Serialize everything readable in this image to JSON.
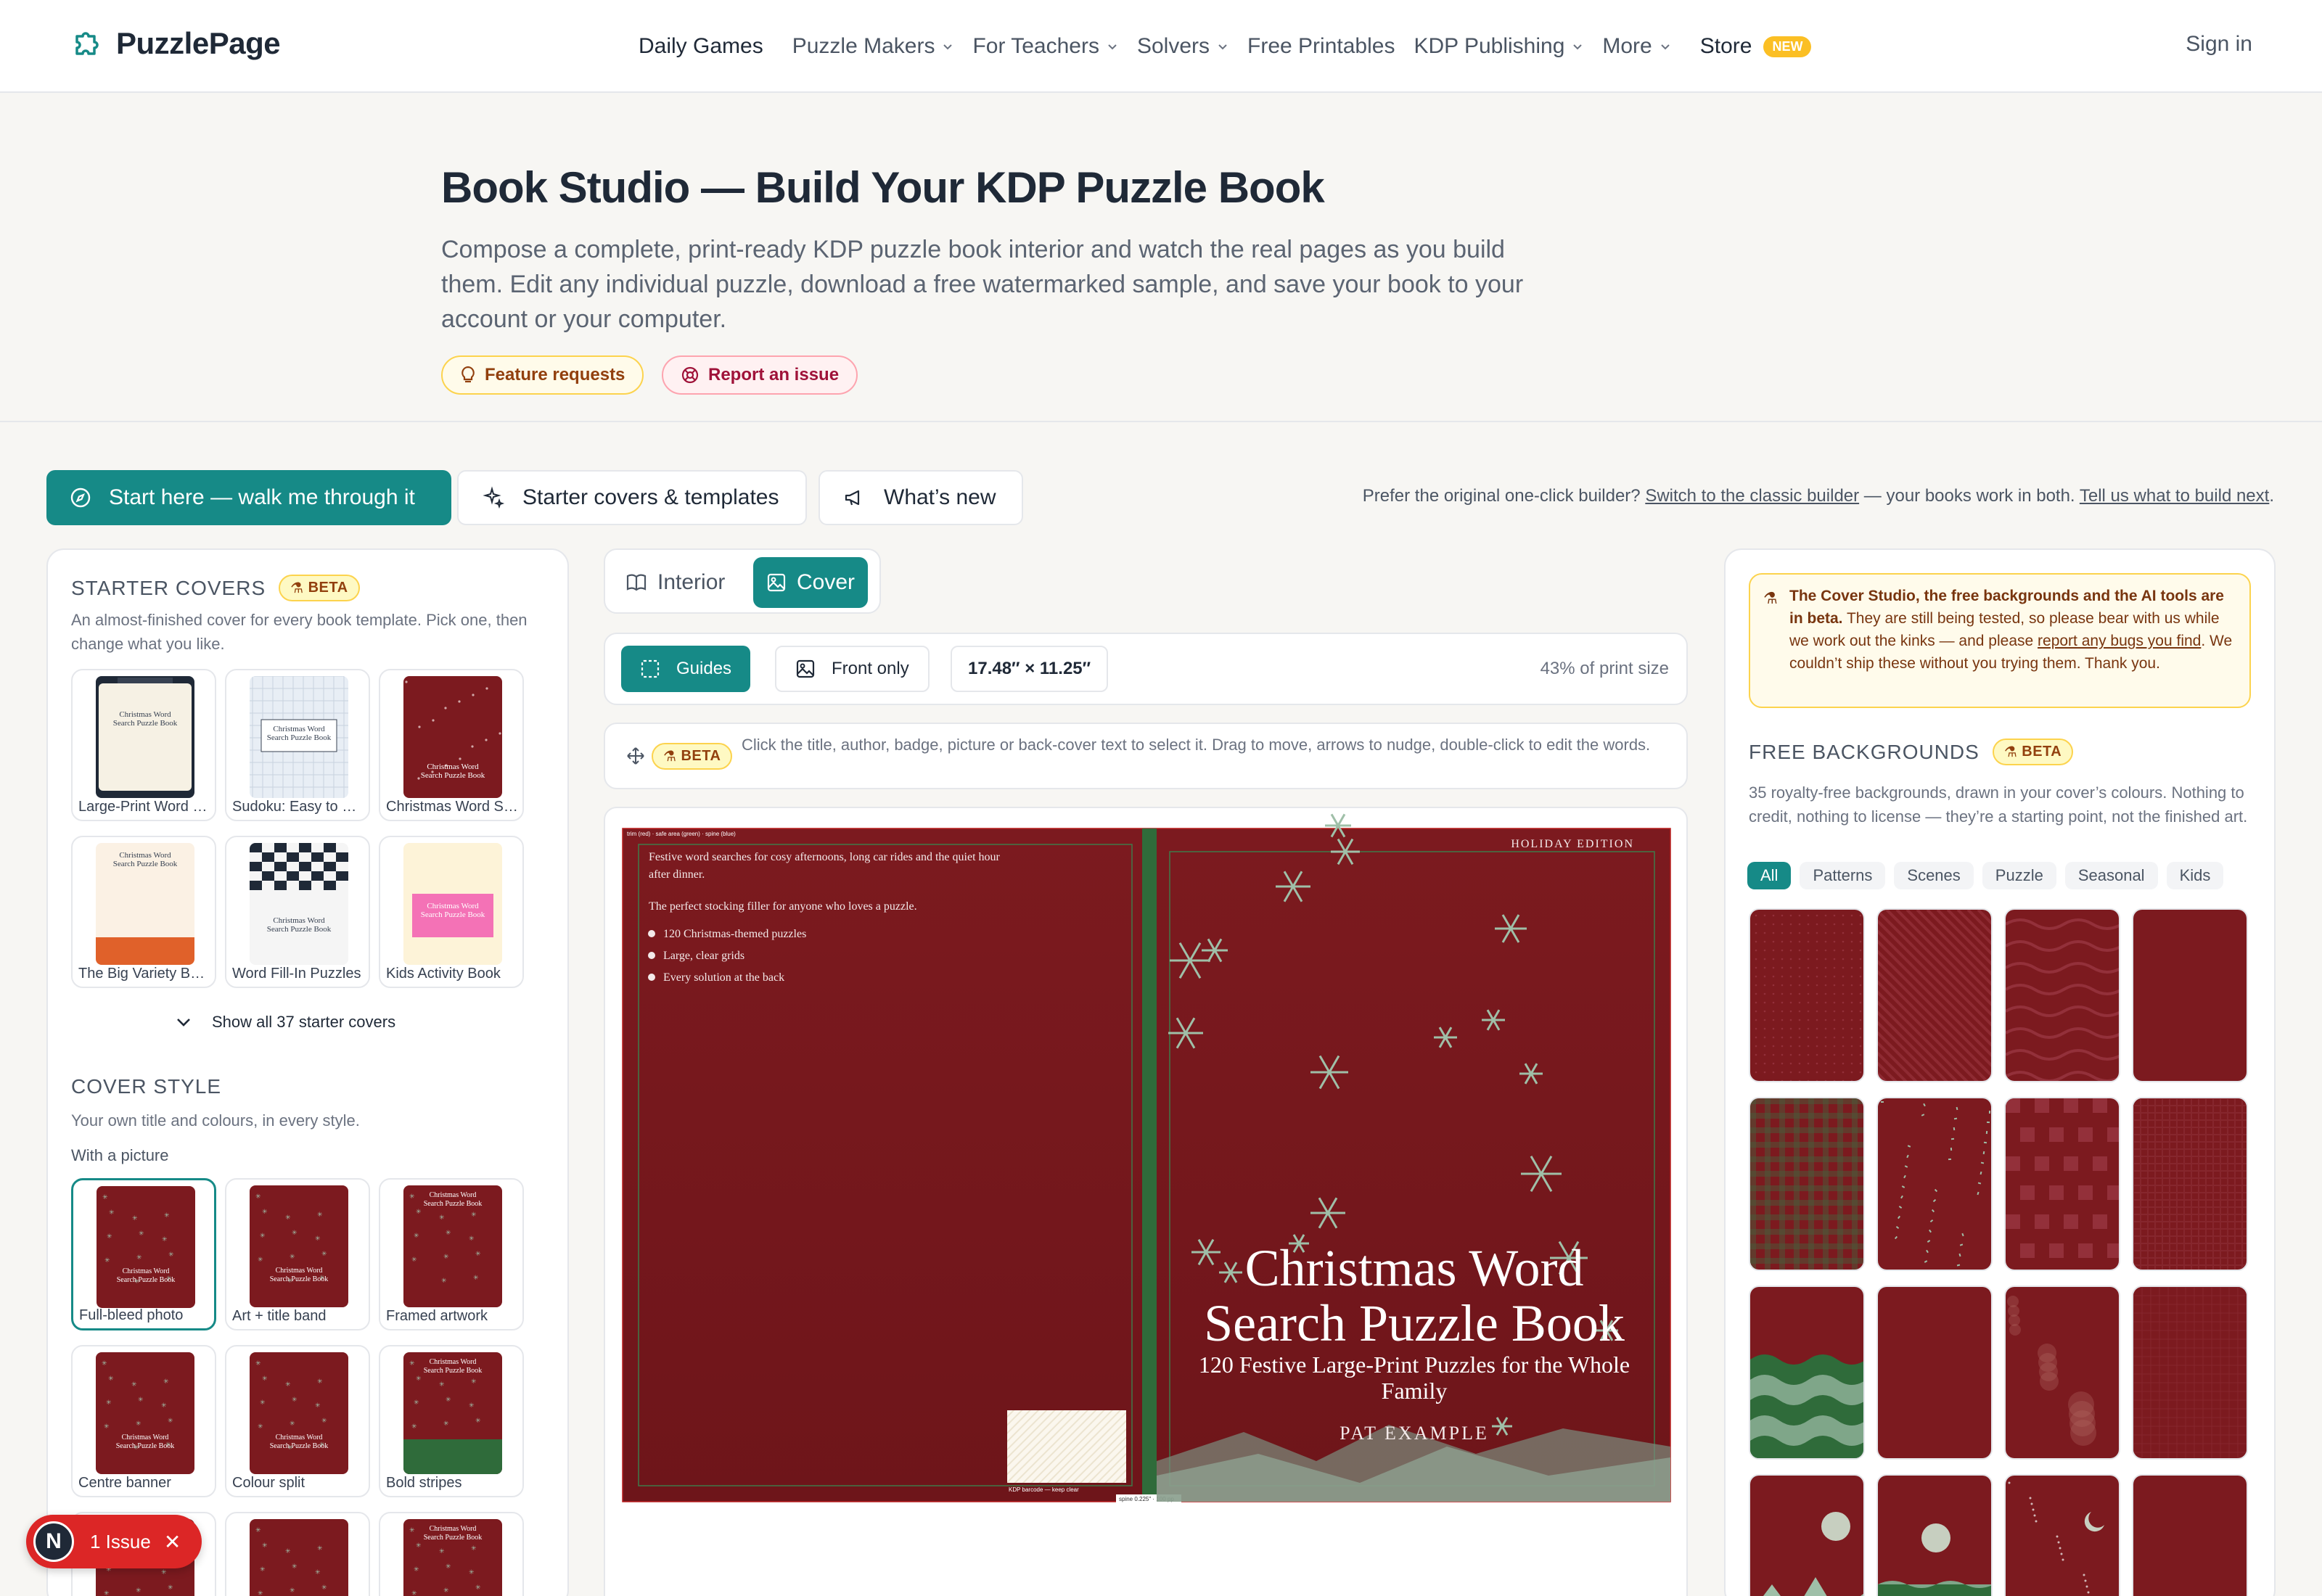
{
  "nav": {
    "brand": "PuzzlePage",
    "links": [
      {
        "label": "Daily Games",
        "dropdown": false,
        "dark": true
      },
      {
        "label": "Puzzle Makers",
        "dropdown": true
      },
      {
        "label": "For Teachers",
        "dropdown": true
      },
      {
        "label": "Solvers",
        "dropdown": true
      },
      {
        "label": "Free Printables",
        "dropdown": false
      },
      {
        "label": "KDP Publishing",
        "dropdown": true
      },
      {
        "label": "More",
        "dropdown": true
      }
    ],
    "store_label": "Store",
    "store_badge": "NEW",
    "signin": "Sign in"
  },
  "hero": {
    "title": "Book Studio — Build Your KDP Puzzle Book",
    "description": "Compose a complete, print-ready KDP puzzle book interior and watch the real pages as you build them. Edit any individual puzzle, download a free watermarked sample, and save your book to your account or your computer.",
    "feature_requests": "Feature requests",
    "report_issue": "Report an issue"
  },
  "toolbar": {
    "start_here": "Start here — walk me through it",
    "starter_covers": "Starter covers & templates",
    "whats_new": "What’s new",
    "note_prefix": "Prefer the original one-click builder?",
    "note_link1": "Switch to the classic builder",
    "note_middle": "— your books work in both.",
    "note_link2": "Tell us what to build next",
    "note_suffix": "."
  },
  "starter_covers": {
    "heading": "STARTER COVERS",
    "beta": "BETA",
    "description": "An almost-finished cover for every book template. Pick one, then change what you like.",
    "items": [
      {
        "label": "Large-Print Word Search",
        "thumb_text": "Christmas Word Search Puzzle Book"
      },
      {
        "label": "Sudoku: Easy to Hard",
        "thumb_text": "Christmas Word Search Puzzle Book"
      },
      {
        "label": "Christmas Word Search",
        "thumb_text": "Christmas Word Search Puzzle Book"
      },
      {
        "label": "The Big Variety Book",
        "thumb_text": "Christmas Word Search Puzzle Book"
      },
      {
        "label": "Word Fill-In Puzzles",
        "thumb_text": "Christmas Word Search Puzzle Book"
      },
      {
        "label": "Kids Activity Book",
        "thumb_text": "Christmas Word Search Puzzle Book"
      }
    ],
    "show_all": "Show all 37 starter covers"
  },
  "cover_style": {
    "heading": "COVER STYLE",
    "description": "Your own title and colours, in every style.",
    "subheading": "With a picture",
    "items": [
      {
        "label": "Full-bleed photo"
      },
      {
        "label": "Art + title band"
      },
      {
        "label": "Framed artwork"
      },
      {
        "label": "Centre banner"
      },
      {
        "label": "Colour split"
      },
      {
        "label": "Bold stripes"
      },
      {
        "label": ""
      },
      {
        "label": ""
      },
      {
        "label": ""
      }
    ]
  },
  "editor": {
    "tab_interior": "Interior",
    "tab_cover": "Cover",
    "guides": "Guides",
    "front_only": "Front only",
    "size": "17.48″ × 11.25″",
    "print_pct": "43% of print size",
    "beta": "BETA",
    "hint": "Click the title, author, badge, picture or back-cover text to select it. Drag to move, arrows to nudge, double-click to edit the words."
  },
  "cover": {
    "guide_label": "trim (red) · safe area (green) · spine (blue)",
    "back_blurb": "Festive word searches for cosy afternoons, long car rides and the quiet hour after dinner.",
    "back_tag": "The perfect stocking filler for anyone who loves a puzzle.",
    "bullets": [
      "120 Christmas-themed puzzles",
      "Large, clear grids",
      "Every solution at the back"
    ],
    "barcode_label": "KDP barcode — keep clear",
    "spine_label": "spine 0.225″ · 100 pp",
    "badge": "HOLIDAY EDITION",
    "title_line1": "Christmas Word",
    "title_line2": "Search Puzzle Book",
    "subtitle_line1": "120 Festive Large-Print Puzzles for the Whole",
    "subtitle_line2": "Family",
    "author": "PAT EXAMPLE",
    "colors": {
      "background": "#7c1a1f",
      "accent": "#9fbfa8",
      "spine": "#2f6b3a"
    }
  },
  "notice": {
    "bold": "The Cover Studio, the free backgrounds and the AI tools are in beta.",
    "body": "They are still being tested, so please bear with us while we work out the kinks — and please",
    "link": "report any bugs you find",
    "tail": ". We couldn’t ship these without you trying them. Thank you."
  },
  "backgrounds": {
    "heading": "FREE BACKGROUNDS",
    "beta": "BETA",
    "description": "35 royalty-free backgrounds, drawn in your cover’s colours. Nothing to credit, nothing to license — they’re a starting point, not the finished art.",
    "filters": [
      "All",
      "Patterns",
      "Scenes",
      "Puzzle",
      "Seasonal",
      "Kids"
    ],
    "selected_filter": "All"
  },
  "issue_toast": {
    "avatar": "N",
    "label": "1 Issue",
    "close": "✕"
  },
  "colors": {
    "brand": "#168a87",
    "cover_red": "#7c1a1f",
    "beta_bg": "#fef9c3"
  }
}
